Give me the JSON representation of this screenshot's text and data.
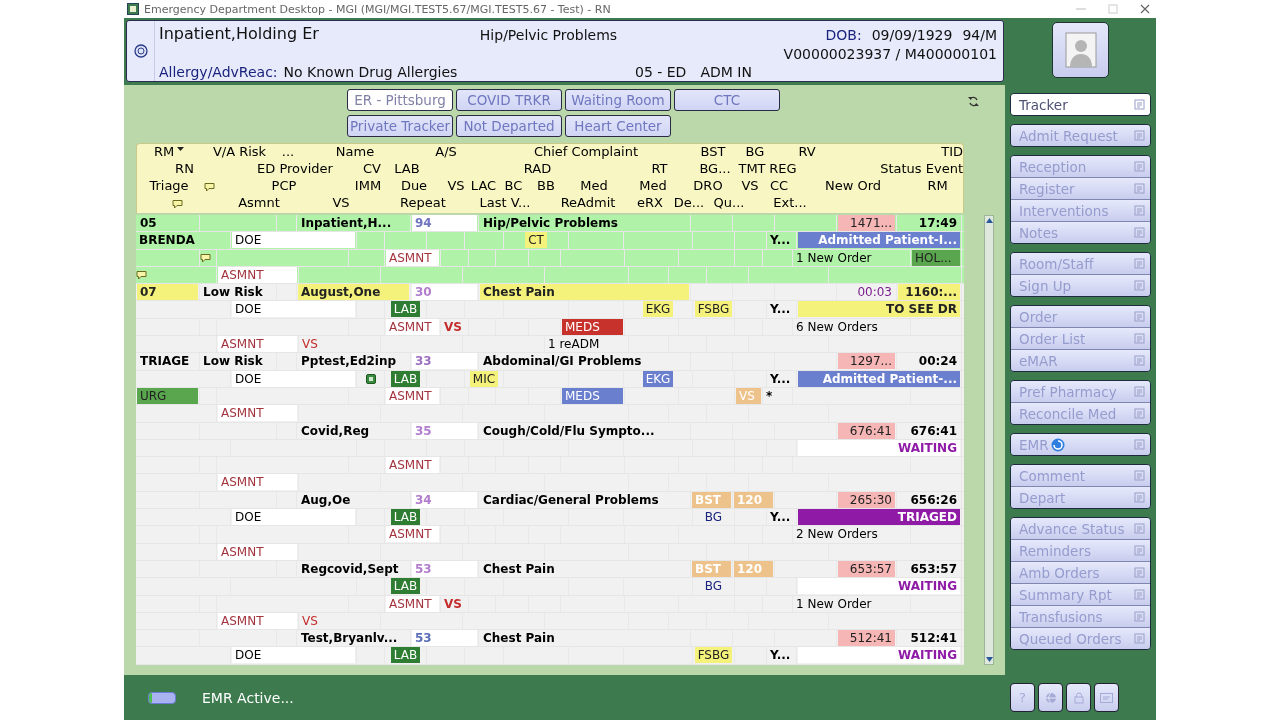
{
  "window": {
    "title": "Emergency Department Desktop - MGI (MGI/MGI.TEST5.67/MGI.TEST5.67 - Test) - RN"
  },
  "patient_header": {
    "name": "Inpatient,Holding Er",
    "complaint": "Hip/Pelvic Problems",
    "dob_label": "DOB:",
    "dob": "09/09/1929",
    "age_sex": "94/M",
    "account": "V00000023937 / M400000101",
    "allergy_label": "Allergy/AdvReac:",
    "allergy": "No Known Drug Allergies",
    "location": "05 - ED",
    "status": "ADM IN"
  },
  "tracker_tabs": [
    {
      "label": "ER - Pittsburg",
      "selected": true
    },
    {
      "label": "COVID TRKR",
      "selected": false
    },
    {
      "label": "Waiting Room",
      "selected": false
    },
    {
      "label": "CTC",
      "selected": false
    },
    {
      "label": "Private Tracker",
      "selected": false
    },
    {
      "label": "Not Departed",
      "selected": false
    },
    {
      "label": "Heart Center",
      "selected": false
    }
  ],
  "tracker": {
    "header_lines": [
      {
        "rm": {
          "text": "RM",
          "sorted": true
        },
        "va_risk": "V/A Risk",
        "column_3": "...",
        "name": "Name",
        "age": "A/S",
        "complaint": "Chief Complaint",
        "bst": "BST",
        "bg": "BG",
        "rv": "RV",
        "tid": "TID"
      },
      {
        "rn": "RN",
        "ed_provider": "ED Provider",
        "cv": "CV",
        "lab": "LAB",
        "rad": "RAD",
        "rt": "RT",
        "bg": "BG...",
        "tmt": "TMT",
        "reg": "REG",
        "status_event": "Status Event"
      },
      {
        "triage": "Triage",
        "note": {
          "kind": "note"
        },
        "pcp": "PCP",
        "imm": "IMM",
        "due": "Due",
        "vs": "VS",
        "lac": "LAC",
        "bc": "BC",
        "bb": "BB",
        "med": "Med",
        "med_2": "Med",
        "dro": "DRO",
        "vs_2": "VS",
        "cc": "CC",
        "new_ord": "New Ord",
        "rm": "RM"
      },
      {
        "note": {
          "kind": "note"
        },
        "asmnt": "Asmnt",
        "vs": "VS",
        "repeat": "Repeat",
        "last_v": "Last V...",
        "readmit": "ReAdmit",
        "erx": "eRX",
        "de": "De...",
        "qu": "Qu...",
        "ext": "Ext..."
      }
    ],
    "rows": [
      {
        "selected": true,
        "lines": [
          {
            "rm": "05",
            "name": "Inpatient,H...",
            "age": {
              "text": "94",
              "kind": "text",
              "color": "#6f73c0"
            },
            "complaint": "Hip/Pelvic Problems",
            "timer": {
              "text": "1471...",
              "kind": "badge",
              "color": "#f6b6b6"
            },
            "tid": "17:49"
          },
          {
            "rn": "BRENDA",
            "ed_provider": "DOE",
            "rad": {
              "text": "CT",
              "kind": "badge",
              "color": "#f5f27c"
            },
            "reg": "Y...",
            "status_event": {
              "text": "Admitted Patient-I...",
              "kind": "chip",
              "color": "#6b7fcf"
            }
          },
          {
            "note": {
              "kind": "note"
            },
            "due": {
              "text": "ASMNT",
              "kind": "text",
              "color": "#a3333d"
            },
            "new_ord": "1 New Order",
            "rm": {
              "text": "HOL...",
              "kind": "badge",
              "color": "#5aa64e"
            }
          },
          {
            "note": {
              "kind": "note"
            },
            "asmnt": {
              "text": "ASMNT",
              "kind": "text",
              "color": "#a3333d"
            }
          }
        ]
      },
      {
        "selected": false,
        "lines": [
          {
            "rm": {
              "text": "07",
              "kind": "badge",
              "color": "#f5f27c"
            },
            "va_risk": "Low Risk",
            "name": {
              "text": "August,One",
              "kind": "badge",
              "color": "#f5f27c"
            },
            "age": {
              "text": "30",
              "kind": "text",
              "color": "#b27dcc"
            },
            "complaint": {
              "text": "Chest Pain",
              "kind": "badge",
              "color": "#f5f27c"
            },
            "timer": {
              "text": "00:03",
              "kind": "text",
              "color": "#7b1f8e"
            },
            "tid": {
              "text": "1160:...",
              "kind": "badge",
              "color": "#f5f27c"
            }
          },
          {
            "ed_provider": "DOE",
            "lab": {
              "text": "LAB",
              "kind": "chip",
              "color": "#2e7d32"
            },
            "rt": {
              "text": "EKG",
              "kind": "badge",
              "color": "#f5f27c"
            },
            "bg": {
              "text": "FSBG",
              "kind": "badge",
              "color": "#f5f27c"
            },
            "reg": "Y...",
            "status_event": {
              "text": "TO SEE DR",
              "kind": "badge",
              "color": "#f5f27c"
            }
          },
          {
            "due": {
              "text": "ASMNT",
              "kind": "text",
              "color": "#a3333d"
            },
            "vs": {
              "text": "VS",
              "kind": "text",
              "color": "#c42c2c"
            },
            "med": {
              "text": "MEDS",
              "kind": "chip",
              "color": "#c8322d"
            },
            "new_ord": "6 New Orders"
          },
          {
            "asmnt": {
              "text": "ASMNT",
              "kind": "text",
              "color": "#a3333d"
            },
            "vs": {
              "text": "VS",
              "kind": "text",
              "color": "#c42c2c"
            },
            "readmit": "1 reADM"
          }
        ]
      },
      {
        "selected": false,
        "lines": [
          {
            "rm": "TRIAGE",
            "va_risk": "Low Risk",
            "name": "Pptest,Ed2inp",
            "age": {
              "text": "33",
              "kind": "text",
              "color": "#9c6fc0"
            },
            "complaint": "Abdominal/GI Problems",
            "timer": {
              "text": "1297...",
              "kind": "badge",
              "color": "#f6b6b6"
            },
            "tid": "00:24"
          },
          {
            "ed_provider": "DOE",
            "cv": {
              "kind": "tag"
            },
            "lab": {
              "text": "LAB",
              "kind": "chip",
              "color": "#2e7d32"
            },
            "column_6": {
              "text": "MIC",
              "kind": "badge",
              "color": "#f5f27c"
            },
            "rt": {
              "text": "EKG",
              "kind": "chip",
              "color": "#6b7fcf"
            },
            "reg": "Y...",
            "status_event": {
              "text": "Admitted Patient-...",
              "kind": "chip",
              "color": "#6b7fcf"
            }
          },
          {
            "triage": {
              "text": "URG",
              "kind": "badge",
              "color": "#5aa64e"
            },
            "due": {
              "text": "ASMNT",
              "kind": "text",
              "color": "#a3333d"
            },
            "med": {
              "text": "MEDS",
              "kind": "chip",
              "color": "#6b7fcf"
            },
            "vs_2": {
              "text": "VS",
              "kind": "chip",
              "color": "#eec38b"
            },
            "cc": "*"
          },
          {
            "asmnt": {
              "text": "ASMNT",
              "kind": "text",
              "color": "#a3333d"
            }
          }
        ]
      },
      {
        "selected": false,
        "lines": [
          {
            "name": "Covid,Reg",
            "age": {
              "text": "35",
              "kind": "text",
              "color": "#b27dcc"
            },
            "complaint": "Cough/Cold/Flu Sympto...",
            "timer": {
              "text": "676:41",
              "kind": "badge",
              "color": "#f6b6b6"
            },
            "tid": "676:41"
          },
          {
            "status_event": {
              "text": "WAITING",
              "kind": "text",
              "color": "#8e1aa6"
            }
          },
          {
            "due": {
              "text": "ASMNT",
              "kind": "text",
              "color": "#a3333d"
            }
          },
          {
            "asmnt": {
              "text": "ASMNT",
              "kind": "text",
              "color": "#a3333d"
            }
          }
        ]
      },
      {
        "selected": false,
        "lines": [
          {
            "name": "Aug,Oe",
            "age": {
              "text": "34",
              "kind": "text",
              "color": "#b27dcc"
            },
            "complaint": "Cardiac/General Problems",
            "bst": {
              "text": "BST",
              "kind": "chip",
              "color": "#eec38b"
            },
            "bg": {
              "text": "120",
              "kind": "chip",
              "color": "#eec38b"
            },
            "timer": {
              "text": "265:30",
              "kind": "badge",
              "color": "#f6b6b6"
            },
            "tid": "656:26"
          },
          {
            "ed_provider": "DOE",
            "lab": {
              "text": "LAB",
              "kind": "chip",
              "color": "#2e7d32"
            },
            "bg": {
              "text": "BG",
              "kind": "text",
              "color": "#1a237e"
            },
            "reg": "Y...",
            "status_event": {
              "text": "TRIAGED",
              "kind": "chip",
              "color": "#8e1aa6"
            }
          },
          {
            "due": {
              "text": "ASMNT",
              "kind": "text",
              "color": "#a3333d"
            },
            "new_ord": "2 New Orders"
          },
          {
            "asmnt": {
              "text": "ASMNT",
              "kind": "text",
              "color": "#a3333d"
            }
          }
        ]
      },
      {
        "selected": false,
        "lines": [
          {
            "name": "Regcovid,Sept",
            "age": {
              "text": "53",
              "kind": "text",
              "color": "#b27dcc"
            },
            "complaint": "Chest Pain",
            "bst": {
              "text": "BST",
              "kind": "chip",
              "color": "#eec38b"
            },
            "bg": {
              "text": "120",
              "kind": "chip",
              "color": "#eec38b"
            },
            "timer": {
              "text": "653:57",
              "kind": "badge",
              "color": "#f6b6b6"
            },
            "tid": "653:57"
          },
          {
            "lab": {
              "text": "LAB",
              "kind": "chip",
              "color": "#2e7d32"
            },
            "bg": {
              "text": "BG",
              "kind": "text",
              "color": "#1a237e"
            },
            "status_event": {
              "text": "WAITING",
              "kind": "text",
              "color": "#8e1aa6"
            }
          },
          {
            "due": {
              "text": "ASMNT",
              "kind": "text",
              "color": "#a3333d"
            },
            "vs": {
              "text": "VS",
              "kind": "text",
              "color": "#c42c2c"
            },
            "new_ord": "1 New Order"
          },
          {
            "asmnt": {
              "text": "ASMNT",
              "kind": "text",
              "color": "#a3333d"
            },
            "vs": {
              "text": "VS",
              "kind": "text",
              "color": "#c42c2c"
            }
          }
        ]
      },
      {
        "selected": false,
        "lines": [
          {
            "name": "Test,Bryanlv...",
            "age": {
              "text": "53",
              "kind": "text",
              "color": "#5b6fb8"
            },
            "complaint": "Chest Pain",
            "timer": {
              "text": "512:41",
              "kind": "badge",
              "color": "#f6b6b6"
            },
            "tid": "512:41"
          },
          {
            "ed_provider": "DOE",
            "lab": {
              "text": "LAB",
              "kind": "chip",
              "color": "#2e7d32"
            },
            "bg": {
              "text": "FSBG",
              "kind": "badge",
              "color": "#f5f27c"
            },
            "reg": "Y...",
            "status_event": {
              "text": "WAITING",
              "kind": "text",
              "color": "#8e1aa6"
            }
          }
        ]
      }
    ]
  },
  "sidebar": {
    "groups": [
      {
        "items": [
          {
            "label": "Tracker",
            "selected": true,
            "disabled": false,
            "busy": false
          }
        ]
      },
      {
        "items": [
          {
            "label": "Admit Request",
            "selected": false,
            "disabled": true,
            "busy": false
          }
        ]
      },
      {
        "items": [
          {
            "label": "Reception",
            "selected": false,
            "disabled": true,
            "busy": false
          },
          {
            "label": "Register",
            "selected": false,
            "disabled": true,
            "busy": false
          },
          {
            "label": "Interventions",
            "selected": false,
            "disabled": true,
            "busy": false
          },
          {
            "label": "Notes",
            "selected": false,
            "disabled": true,
            "busy": false
          }
        ]
      },
      {
        "items": [
          {
            "label": "Room/Staff",
            "selected": false,
            "disabled": true,
            "busy": false
          },
          {
            "label": "Sign Up",
            "selected": false,
            "disabled": true,
            "busy": false
          }
        ]
      },
      {
        "items": [
          {
            "label": "Order",
            "selected": false,
            "disabled": true,
            "busy": false
          },
          {
            "label": "Order List",
            "selected": false,
            "disabled": true,
            "busy": false
          },
          {
            "label": "eMAR",
            "selected": false,
            "disabled": true,
            "busy": false
          }
        ]
      },
      {
        "items": [
          {
            "label": "Pref Pharmacy",
            "selected": false,
            "disabled": true,
            "busy": false
          },
          {
            "label": "Reconcile Med",
            "selected": false,
            "disabled": true,
            "busy": false
          }
        ]
      },
      {
        "items": [
          {
            "label": "EMR",
            "selected": false,
            "disabled": true,
            "busy": true
          }
        ]
      },
      {
        "items": [
          {
            "label": "Comment",
            "selected": false,
            "disabled": true,
            "busy": false
          },
          {
            "label": "Depart",
            "selected": false,
            "disabled": true,
            "busy": false
          }
        ]
      },
      {
        "items": [
          {
            "label": "Advance Status",
            "selected": false,
            "disabled": true,
            "busy": false
          },
          {
            "label": "Reminders",
            "selected": false,
            "disabled": true,
            "busy": false
          },
          {
            "label": "Amb Orders",
            "selected": false,
            "disabled": true,
            "busy": false
          },
          {
            "label": "Summary Rpt",
            "selected": false,
            "disabled": true,
            "busy": false
          },
          {
            "label": "Transfusions",
            "selected": false,
            "disabled": true,
            "busy": false
          },
          {
            "label": "Queued Orders",
            "selected": false,
            "disabled": true,
            "busy": false
          }
        ]
      }
    ],
    "bottom_buttons": [
      {
        "kind": "help",
        "label": "?"
      },
      {
        "kind": "globe"
      },
      {
        "kind": "lock"
      },
      {
        "kind": "card"
      }
    ]
  },
  "status_bar": {
    "progress": {
      "level": 0.12
    },
    "text": "EMR Active..."
  }
}
